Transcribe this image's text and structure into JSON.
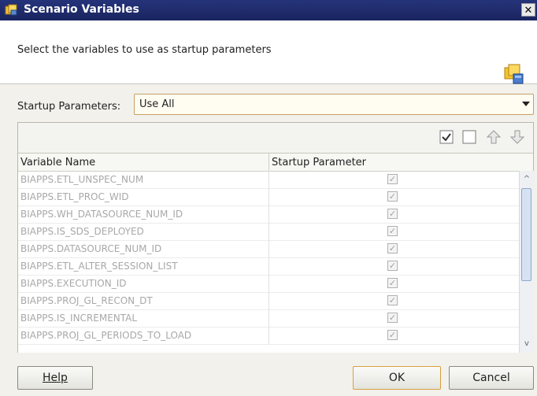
{
  "window": {
    "title": "Scenario Variables",
    "close_glyph": "✕"
  },
  "header": {
    "description": "Select the variables to use as startup parameters",
    "icon": "variables-icon"
  },
  "startup": {
    "label": "Startup Parameters:",
    "selected": "Use All"
  },
  "table": {
    "columns": [
      "Variable Name",
      "Startup Parameter"
    ],
    "rows": [
      {
        "name": "BIAPPS.ETL_UNSPEC_NUM",
        "checked": true
      },
      {
        "name": "BIAPPS.ETL_PROC_WID",
        "checked": true
      },
      {
        "name": "BIAPPS.WH_DATASOURCE_NUM_ID",
        "checked": true
      },
      {
        "name": "BIAPPS.IS_SDS_DEPLOYED",
        "checked": true
      },
      {
        "name": "BIAPPS.DATASOURCE_NUM_ID",
        "checked": true
      },
      {
        "name": "BIAPPS.ETL_ALTER_SESSION_LIST",
        "checked": true
      },
      {
        "name": "BIAPPS.EXECUTION_ID",
        "checked": true
      },
      {
        "name": "BIAPPS.PROJ_GL_RECON_DT",
        "checked": true
      },
      {
        "name": "BIAPPS.IS_INCREMENTAL",
        "checked": true
      },
      {
        "name": "BIAPPS.PROJ_GL_PERIODS_TO_LOAD",
        "checked": true
      }
    ]
  },
  "buttons": {
    "help": "Help",
    "ok": "OK",
    "cancel": "Cancel"
  }
}
